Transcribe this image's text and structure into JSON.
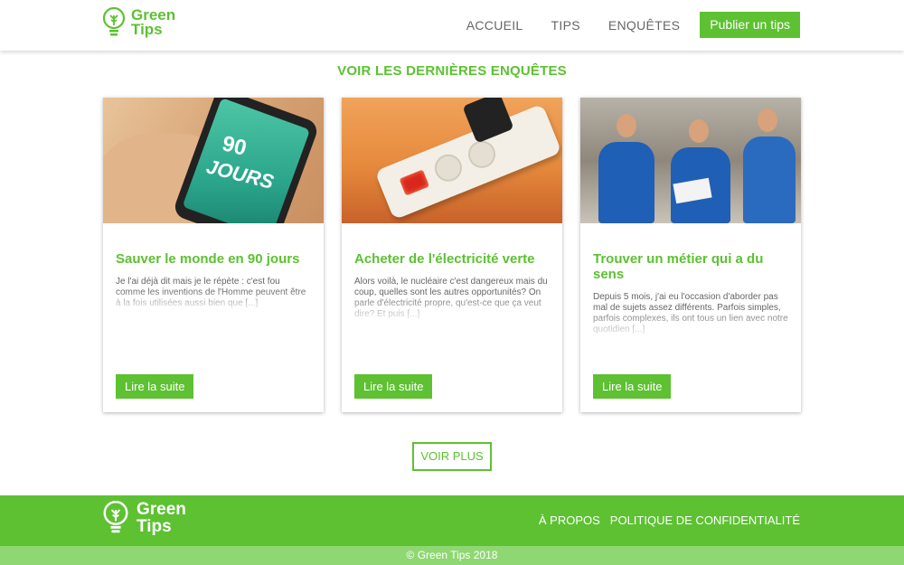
{
  "header": {
    "logo_line1": "Green",
    "logo_line2": "Tips",
    "nav": [
      "ACCUEIL",
      "TIPS",
      "ENQUÊTES"
    ],
    "publish_label": "Publier un tips"
  },
  "section_title": "VOIR LES DERNIÈRES ENQUÊTES",
  "cards": [
    {
      "image_text_1": "90",
      "image_text_2": "JOURS",
      "title": "Sauver le monde en 90 jours",
      "excerpt": "Je l'ai déjà dit mais je le répète : c'est fou comme les inventions de l'Homme peuvent être à la fois utilisées aussi bien que [...]",
      "button": "Lire la suite"
    },
    {
      "title": "Acheter de l'électricité verte",
      "excerpt": "Alors voilà, le nucléaire c'est dangereux mais du coup, quelles sont les autres opportunités? On parle d'électricité propre, qu'est-ce que ça veut dire? Et puis [...]",
      "button": "Lire la suite"
    },
    {
      "title": "Trouver un métier qui a du sens",
      "excerpt": "Depuis 5 mois, j'ai eu l'occasion d'aborder pas mal de sujets assez différents. Parfois simples, parfois complexes, ils ont tous un lien avec notre quotidien [...]",
      "button": "Lire la suite"
    }
  ],
  "voir_plus": "VOIR PLUS",
  "footer": {
    "logo_line1": "Green",
    "logo_line2": "Tips",
    "links": [
      "À PROPOS",
      "POLITIQUE DE CONFIDENTIALITÉ"
    ],
    "copyright": "© Green Tips 2018"
  },
  "colors": {
    "brand_green": "#5dc132",
    "light_green": "#8fd773"
  },
  "icons": {
    "logo": "lightbulb-leaf-icon"
  }
}
